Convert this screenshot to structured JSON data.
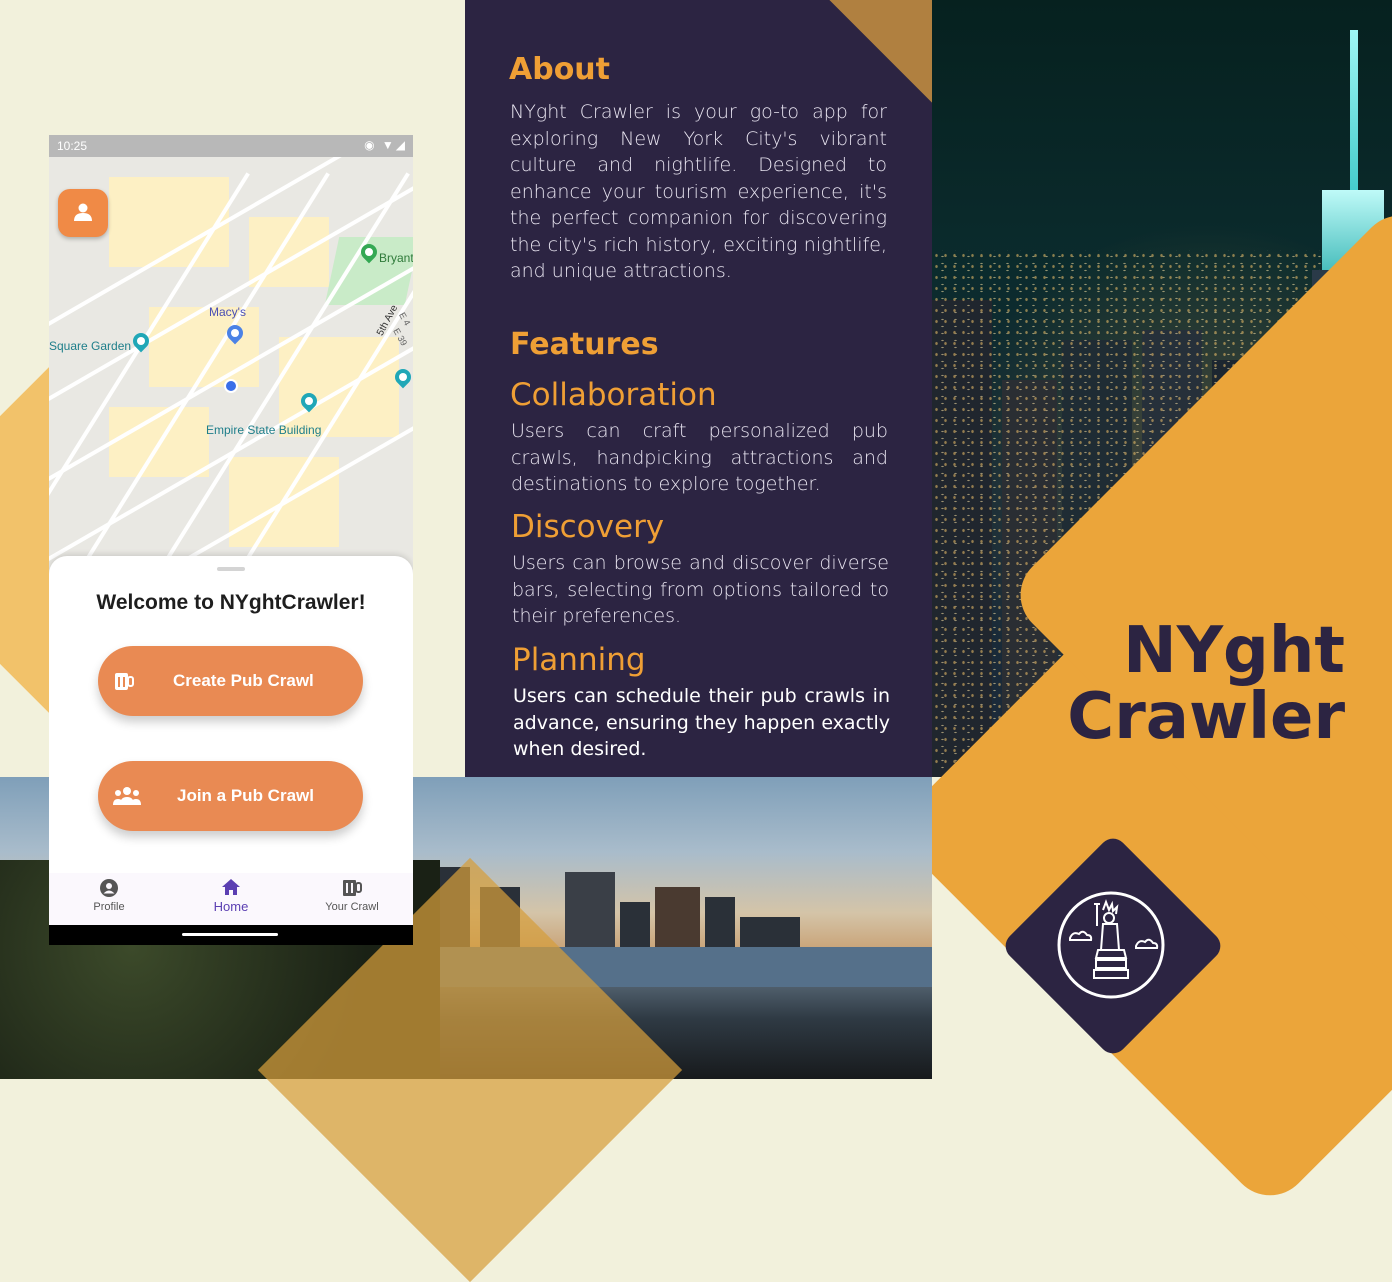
{
  "about": {
    "heading": "About",
    "body": "NYght Crawler is your go-to app for exploring New York City's vibrant culture and nightlife. Designed to enhance your tourism experience, it's the perfect companion for discovering the city's rich history, exciting nightlife, and unique attractions."
  },
  "features": {
    "heading": "Features",
    "items": [
      {
        "title": "Collaboration",
        "text": "Users can craft personalized pub crawls, handpicking attractions and destinations to explore together."
      },
      {
        "title": "Discovery",
        "text": "Users can  browse and discover diverse bars, selecting from  options tailored to their preferences."
      },
      {
        "title": "Planning",
        "text": "Users can schedule their pub crawls in advance, ensuring they happen exactly when desired."
      }
    ]
  },
  "brand": {
    "title_line1": "NYght",
    "title_line2": "Crawler",
    "logo_icon": "statue-of-liberty-icon",
    "colors": {
      "purple": "#2c2442",
      "gold": "#eba53a",
      "orange": "#ef9f35",
      "cream": "#f2f1dc"
    }
  },
  "phone": {
    "status_time": "10:25",
    "status_icons": "◉ ▼◢",
    "map_labels": {
      "bryant": "Bryant",
      "macys": "Macy's",
      "square_garden": "Square Garden",
      "empire": "Empire State Building",
      "fifth_ave": "5th Ave",
      "e_39": "E 39",
      "e_4": "E 4"
    },
    "welcome": "Welcome to NYghtCrawler!",
    "create_button": "Create Pub Crawl",
    "join_button": "Join a Pub Crawl",
    "nav": {
      "profile": "Profile",
      "home": "Home",
      "your_crawl": "Your Crawl"
    }
  }
}
